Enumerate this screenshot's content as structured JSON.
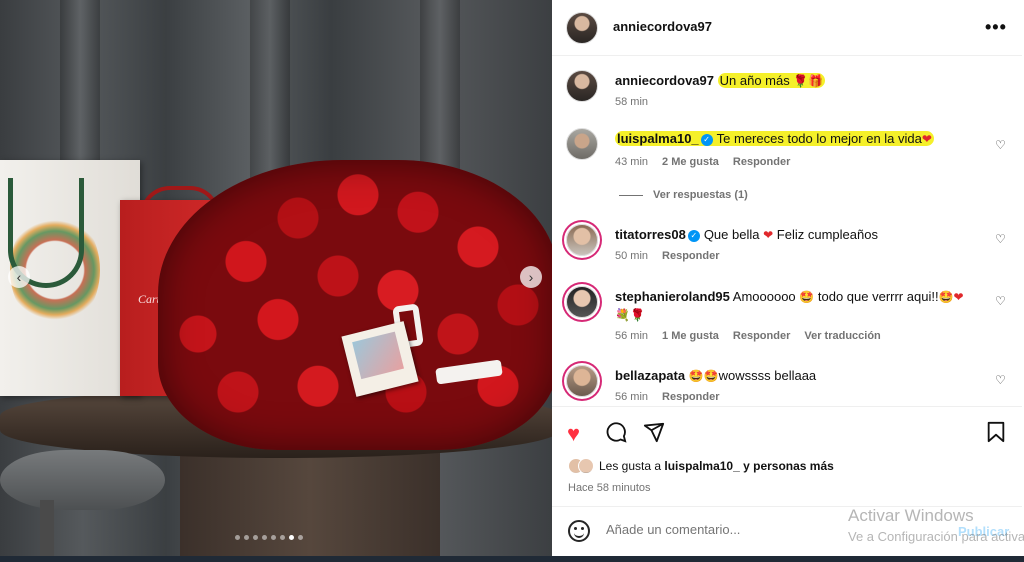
{
  "post_author": {
    "username": "anniecordova97"
  },
  "photo": {
    "bag_brand": "Cartier",
    "carousel_dot_count": 8,
    "carousel_active_index": 6
  },
  "caption": {
    "username": "anniecordova97",
    "text": "Un año más",
    "emojis": "🌹🎁",
    "time": "58 min"
  },
  "comments": [
    {
      "username": "luispalma10_",
      "verified": true,
      "text": "Te mereces todo lo mejor en la vida",
      "emoji": "❤",
      "time": "43 min",
      "likes": "2 Me gusta",
      "reply": "Responder",
      "view_replies": "Ver respuestas (1)"
    },
    {
      "username": "titatorres08",
      "verified": true,
      "text_before": "Que bella",
      "emoji": "❤",
      "text_after": "Feliz cumpleaños",
      "time": "50 min",
      "reply": "Responder"
    },
    {
      "username": "stephanieroland95",
      "text_1": "Amoooooo",
      "emoji_1": "🤩",
      "text_2": "todo que verrrr aqui!!",
      "emoji_2": "🤩❤",
      "line2": "💐🌹",
      "time": "56 min",
      "likes": "1 Me gusta",
      "reply": "Responder",
      "translate": "Ver traducción"
    },
    {
      "username": "bellazapata",
      "emoji": "🤩🤩",
      "text": "wowssss bellaaa",
      "time": "56 min",
      "reply": "Responder"
    }
  ],
  "likes": {
    "prefix": "Les gusta a",
    "user": "luispalma10_",
    "suffix": "y personas más",
    "time_ago": "Hace 58 minutos"
  },
  "add_comment": {
    "placeholder": "Añade un comentario...",
    "post_label": "Publicar"
  },
  "watermark": {
    "line1": "Activar Windows",
    "line2": "Ve a Configuración para activar Windows."
  },
  "icons": {
    "like": "heart-filled-icon",
    "comment": "comment-icon",
    "share": "paper-plane-icon",
    "save": "bookmark-icon",
    "more": "more-dots-icon",
    "emoji": "smiley-icon"
  },
  "colors": {
    "like_red": "#ff3040",
    "verified_blue": "#0095f6",
    "highlight": "#f5f02a",
    "muted_text": "#737373",
    "post_button": "#b2dffc"
  }
}
